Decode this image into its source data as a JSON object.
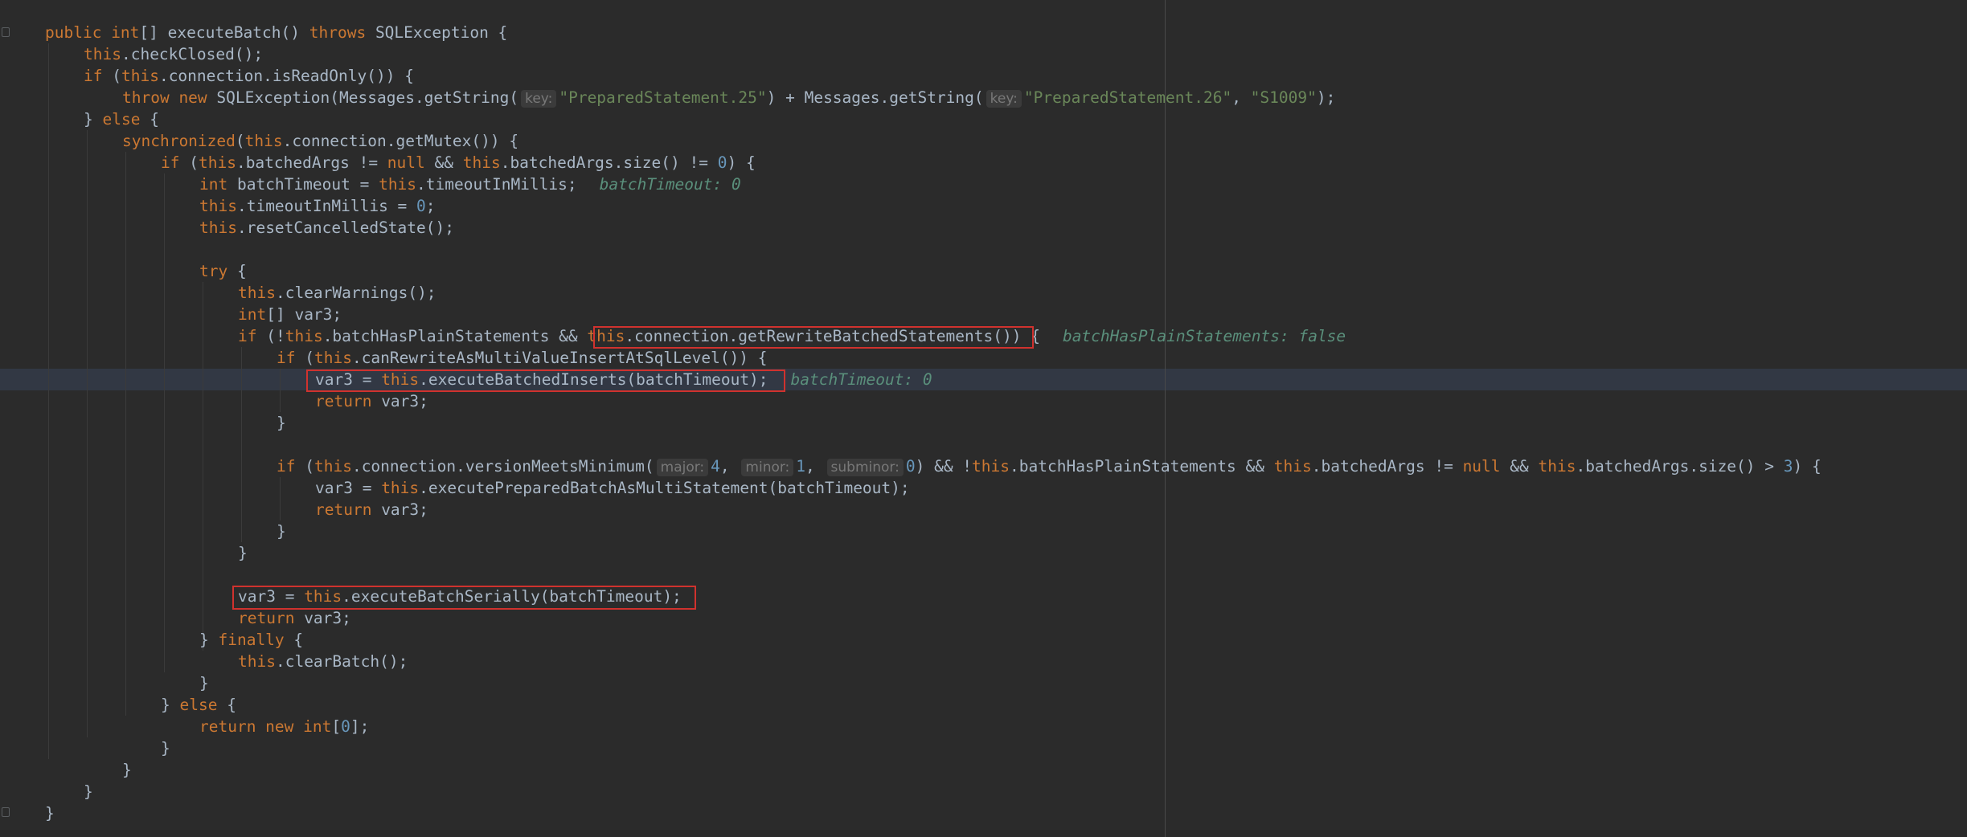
{
  "editor": {
    "lines": [
      {
        "indent": 0,
        "tokens": [
          [
            "kw",
            "public "
          ],
          [
            "kw",
            "int"
          ],
          [
            "t",
            "[] executeBatch() "
          ],
          [
            "kw",
            "throws "
          ],
          [
            "t",
            "SQLException {"
          ]
        ]
      },
      {
        "indent": 1,
        "tokens": [
          [
            "kw",
            "this"
          ],
          [
            "t",
            ".checkClosed();"
          ]
        ]
      },
      {
        "indent": 1,
        "tokens": [
          [
            "kw",
            "if "
          ],
          [
            "t",
            "("
          ],
          [
            "kw",
            "this"
          ],
          [
            "t",
            ".connection.isReadOnly()) {"
          ]
        ]
      },
      {
        "indent": 2,
        "tokens": [
          [
            "kw",
            "throw new "
          ],
          [
            "t",
            "SQLException(Messages.getString("
          ],
          [
            "hint",
            "key:"
          ],
          [
            "str",
            "\"PreparedStatement.25\""
          ],
          [
            "t",
            ") + Messages.getString("
          ],
          [
            "hint",
            "key:"
          ],
          [
            "str",
            "\"PreparedStatement.26\""
          ],
          [
            "t",
            ", "
          ],
          [
            "str",
            "\"S1009\""
          ],
          [
            "t",
            ");"
          ]
        ]
      },
      {
        "indent": 1,
        "tokens": [
          [
            "t",
            "} "
          ],
          [
            "kw",
            "else "
          ],
          [
            "t",
            "{"
          ]
        ]
      },
      {
        "indent": 2,
        "tokens": [
          [
            "kw",
            "synchronized"
          ],
          [
            "t",
            "("
          ],
          [
            "kw",
            "this"
          ],
          [
            "t",
            ".connection.getMutex()) {"
          ]
        ]
      },
      {
        "indent": 3,
        "tokens": [
          [
            "kw",
            "if "
          ],
          [
            "t",
            "("
          ],
          [
            "kw",
            "this"
          ],
          [
            "t",
            ".batchedArgs != "
          ],
          [
            "kw",
            "null "
          ],
          [
            "t",
            "&& "
          ],
          [
            "kw",
            "this"
          ],
          [
            "t",
            ".batchedArgs.size() != "
          ],
          [
            "num",
            "0"
          ],
          [
            "t",
            ") {"
          ]
        ]
      },
      {
        "indent": 4,
        "tokens": [
          [
            "kw",
            "int "
          ],
          [
            "t",
            "batchTimeout = "
          ],
          [
            "kw",
            "this"
          ],
          [
            "t",
            ".timeoutInMillis;"
          ],
          [
            "inlay",
            "batchTimeout: 0"
          ]
        ]
      },
      {
        "indent": 4,
        "tokens": [
          [
            "kw",
            "this"
          ],
          [
            "t",
            ".timeoutInMillis = "
          ],
          [
            "num",
            "0"
          ],
          [
            "t",
            ";"
          ]
        ]
      },
      {
        "indent": 4,
        "tokens": [
          [
            "kw",
            "this"
          ],
          [
            "t",
            ".resetCancelledState();"
          ]
        ]
      },
      {
        "indent": 0,
        "tokens": []
      },
      {
        "indent": 4,
        "tokens": [
          [
            "kw",
            "try "
          ],
          [
            "t",
            "{"
          ]
        ]
      },
      {
        "indent": 5,
        "tokens": [
          [
            "kw",
            "this"
          ],
          [
            "t",
            ".clearWarnings();"
          ]
        ]
      },
      {
        "indent": 5,
        "tokens": [
          [
            "kw",
            "int"
          ],
          [
            "t",
            "[] var3;"
          ]
        ]
      },
      {
        "indent": 5,
        "tokens": [
          [
            "kw",
            "if "
          ],
          [
            "t",
            "(!"
          ],
          [
            "kw",
            "this"
          ],
          [
            "t",
            ".batchHasPlainStatements && "
          ],
          [
            "kw",
            "this"
          ],
          [
            "t",
            ".connection.getRewriteBatchedStatements()) {"
          ],
          [
            "inlay",
            "batchHasPlainStatements: false"
          ]
        ]
      },
      {
        "indent": 6,
        "tokens": [
          [
            "kw",
            "if "
          ],
          [
            "t",
            "("
          ],
          [
            "kw",
            "this"
          ],
          [
            "t",
            ".canRewriteAsMultiValueInsertAtSqlLevel()) {"
          ]
        ]
      },
      {
        "indent": 7,
        "tokens": [
          [
            "t",
            "var3 = "
          ],
          [
            "kw",
            "this"
          ],
          [
            "t",
            ".executeBatchedInserts(batchTimeout);"
          ],
          [
            "inlay",
            "batchTimeout: 0"
          ]
        ]
      },
      {
        "indent": 7,
        "tokens": [
          [
            "kw",
            "return "
          ],
          [
            "t",
            "var3;"
          ]
        ]
      },
      {
        "indent": 6,
        "tokens": [
          [
            "t",
            "}"
          ]
        ]
      },
      {
        "indent": 0,
        "tokens": []
      },
      {
        "indent": 6,
        "tokens": [
          [
            "kw",
            "if "
          ],
          [
            "t",
            "("
          ],
          [
            "kw",
            "this"
          ],
          [
            "t",
            ".connection.versionMeetsMinimum("
          ],
          [
            "hint",
            "major:"
          ],
          [
            "num",
            "4"
          ],
          [
            "t",
            ", "
          ],
          [
            "hint",
            "minor:"
          ],
          [
            "num",
            "1"
          ],
          [
            "t",
            ", "
          ],
          [
            "hint",
            "subminor:"
          ],
          [
            "num",
            "0"
          ],
          [
            "t",
            ") && !"
          ],
          [
            "kw",
            "this"
          ],
          [
            "t",
            ".batchHasPlainStatements && "
          ],
          [
            "kw",
            "this"
          ],
          [
            "t",
            ".batchedArgs != "
          ],
          [
            "kw",
            "null "
          ],
          [
            "t",
            "&& "
          ],
          [
            "kw",
            "this"
          ],
          [
            "t",
            ".batchedArgs.size() > "
          ],
          [
            "num",
            "3"
          ],
          [
            "t",
            ") {"
          ]
        ]
      },
      {
        "indent": 7,
        "tokens": [
          [
            "t",
            "var3 = "
          ],
          [
            "kw",
            "this"
          ],
          [
            "t",
            ".executePreparedBatchAsMultiStatement(batchTimeout);"
          ]
        ]
      },
      {
        "indent": 7,
        "tokens": [
          [
            "kw",
            "return "
          ],
          [
            "t",
            "var3;"
          ]
        ]
      },
      {
        "indent": 6,
        "tokens": [
          [
            "t",
            "}"
          ]
        ]
      },
      {
        "indent": 5,
        "tokens": [
          [
            "t",
            "}"
          ]
        ]
      },
      {
        "indent": 0,
        "tokens": []
      },
      {
        "indent": 5,
        "tokens": [
          [
            "t",
            "var3 = "
          ],
          [
            "kw",
            "this"
          ],
          [
            "t",
            ".executeBatchSerially(batchTimeout);"
          ]
        ]
      },
      {
        "indent": 5,
        "tokens": [
          [
            "kw",
            "return "
          ],
          [
            "t",
            "var3;"
          ]
        ]
      },
      {
        "indent": 4,
        "tokens": [
          [
            "t",
            "} "
          ],
          [
            "kw",
            "finally "
          ],
          [
            "t",
            "{"
          ]
        ]
      },
      {
        "indent": 5,
        "tokens": [
          [
            "kw",
            "this"
          ],
          [
            "t",
            ".clearBatch();"
          ]
        ]
      },
      {
        "indent": 4,
        "tokens": [
          [
            "t",
            "}"
          ]
        ]
      },
      {
        "indent": 3,
        "tokens": [
          [
            "t",
            "} "
          ],
          [
            "kw",
            "else "
          ],
          [
            "t",
            "{"
          ]
        ]
      },
      {
        "indent": 4,
        "tokens": [
          [
            "kw",
            "return new int"
          ],
          [
            "t",
            "["
          ],
          [
            "num",
            "0"
          ],
          [
            "t",
            "];"
          ]
        ]
      },
      {
        "indent": 3,
        "tokens": [
          [
            "t",
            "}"
          ]
        ]
      },
      {
        "indent": 2,
        "tokens": [
          [
            "t",
            "}"
          ]
        ]
      },
      {
        "indent": 1,
        "tokens": [
          [
            "t",
            "}"
          ]
        ]
      },
      {
        "indent": 0,
        "tokens": [
          [
            "t",
            "}"
          ]
        ]
      }
    ]
  }
}
